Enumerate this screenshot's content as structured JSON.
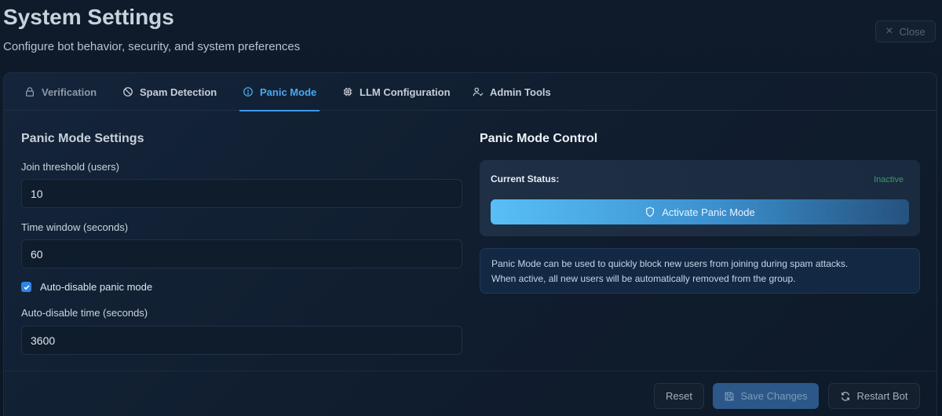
{
  "header": {
    "title": "System Settings",
    "subtitle": "Configure bot behavior, security, and system preferences",
    "close_label": "Close"
  },
  "tabs": [
    {
      "label": "Verification",
      "icon": "lock-icon"
    },
    {
      "label": "Spam Detection",
      "icon": "ban-icon"
    },
    {
      "label": "Panic Mode",
      "icon": "alert-circle-icon",
      "active": true
    },
    {
      "label": "LLM Configuration",
      "icon": "cpu-icon"
    },
    {
      "label": "Admin Tools",
      "icon": "user-check-icon"
    }
  ],
  "settings": {
    "title": "Panic Mode Settings",
    "join_threshold_label": "Join threshold (users)",
    "join_threshold_value": "10",
    "time_window_label": "Time window (seconds)",
    "time_window_value": "60",
    "auto_disable_label": "Auto-disable panic mode",
    "auto_disable_checked": true,
    "auto_disable_time_label": "Auto-disable time (seconds)",
    "auto_disable_time_value": "3600"
  },
  "control": {
    "title": "Panic Mode Control",
    "status_label": "Current Status:",
    "status_value": "Inactive",
    "activate_label": "Activate Panic Mode",
    "info_line1": "Panic Mode can be used to quickly block new users from joining during spam attacks.",
    "info_line2": "When active, all new users will be automatically removed from the group."
  },
  "footer": {
    "reset_label": "Reset",
    "save_label": "Save Changes",
    "restart_label": "Restart Bot"
  },
  "colors": {
    "accent": "#3c97e8",
    "status_inactive": "#3a9a6a"
  }
}
